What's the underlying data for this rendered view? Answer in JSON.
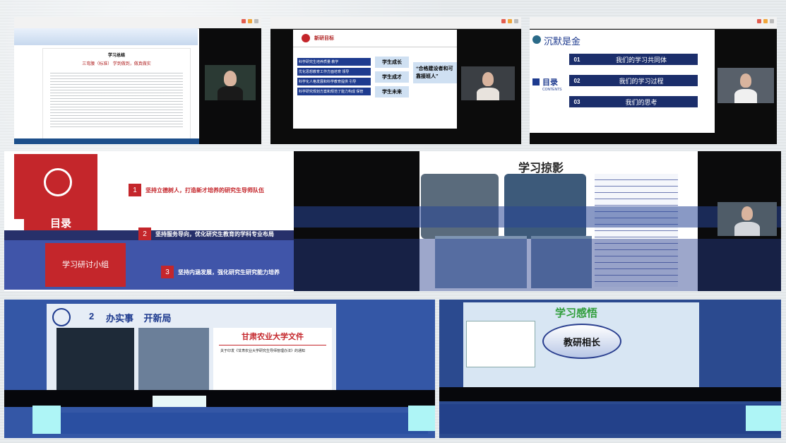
{
  "colors": {
    "accent_red": "#c4262b",
    "navy": "#1e3b8f",
    "dark_navy": "#0d1b4a",
    "page_bg": "#e9edf0"
  },
  "topLeft": {
    "doc_heading": "学习总结",
    "doc_subheading": "三弯腰（标准）   学到做到，做真做实"
  },
  "topMiddle": {
    "header_logo": "新研目标",
    "rows": [
      "科学研究生培养质量 教学",
      "优化思想教育工作方面培育 领导",
      "科学化人格发展和科学教育提供 引导",
      "科学研究规划方案和规范了能力构成 保管"
    ],
    "middle_col": [
      "学生成长",
      "学生成才",
      "学生未来"
    ],
    "right_col": "“合格建设者和可靠接班人”"
  },
  "topRight": {
    "title": "沉默是金",
    "toc_main": "目录",
    "toc_sub": "CONTENTS",
    "items": [
      {
        "num": "01",
        "label": "我们的学习共同体"
      },
      {
        "num": "02",
        "label": "我们的学习过程"
      },
      {
        "num": "03",
        "label": "我们的思考"
      }
    ]
  },
  "midLeft": {
    "toc_label": "目录",
    "group_label": "学习研讨小组",
    "items": [
      {
        "num": "1",
        "label": "坚持立德树人，打造新才培养的研究生导师队伍"
      },
      {
        "num": "2",
        "label": "坚持服务导向，优化研究生教育的学科专业布局"
      },
      {
        "num": "3",
        "label": "坚持内涵发展，强化研究生研究能力培养"
      }
    ]
  },
  "midRight": {
    "title": "学习掠影"
  },
  "bottomLeft": {
    "number": "2",
    "title": "办实事    开新局",
    "doc_title": "甘肃农业大学文件",
    "doc_line": "关于印发《甘肃农业大学研究生导师管理办法》的通知"
  },
  "bottomRight": {
    "title": "学习感悟",
    "badge": "教研相长"
  }
}
